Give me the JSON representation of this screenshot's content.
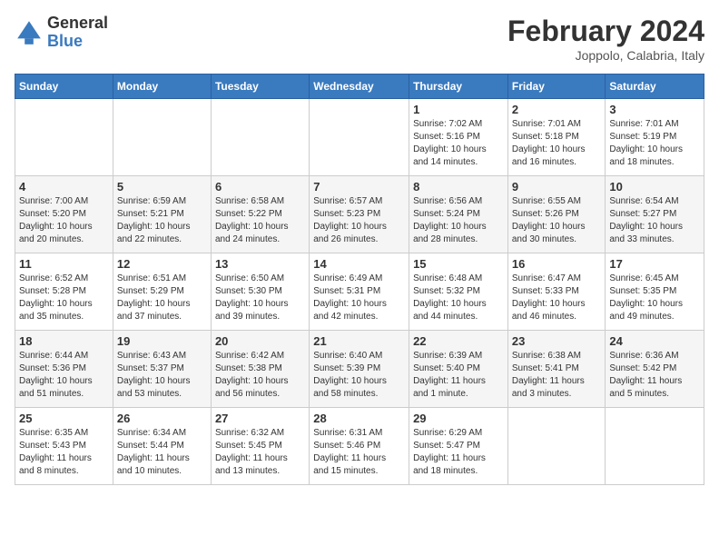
{
  "header": {
    "logo_general": "General",
    "logo_blue": "Blue",
    "month_title": "February 2024",
    "location": "Joppolo, Calabria, Italy"
  },
  "weekdays": [
    "Sunday",
    "Monday",
    "Tuesday",
    "Wednesday",
    "Thursday",
    "Friday",
    "Saturday"
  ],
  "weeks": [
    [
      {
        "day": "",
        "info": ""
      },
      {
        "day": "",
        "info": ""
      },
      {
        "day": "",
        "info": ""
      },
      {
        "day": "",
        "info": ""
      },
      {
        "day": "1",
        "info": "Sunrise: 7:02 AM\nSunset: 5:16 PM\nDaylight: 10 hours\nand 14 minutes."
      },
      {
        "day": "2",
        "info": "Sunrise: 7:01 AM\nSunset: 5:18 PM\nDaylight: 10 hours\nand 16 minutes."
      },
      {
        "day": "3",
        "info": "Sunrise: 7:01 AM\nSunset: 5:19 PM\nDaylight: 10 hours\nand 18 minutes."
      }
    ],
    [
      {
        "day": "4",
        "info": "Sunrise: 7:00 AM\nSunset: 5:20 PM\nDaylight: 10 hours\nand 20 minutes."
      },
      {
        "day": "5",
        "info": "Sunrise: 6:59 AM\nSunset: 5:21 PM\nDaylight: 10 hours\nand 22 minutes."
      },
      {
        "day": "6",
        "info": "Sunrise: 6:58 AM\nSunset: 5:22 PM\nDaylight: 10 hours\nand 24 minutes."
      },
      {
        "day": "7",
        "info": "Sunrise: 6:57 AM\nSunset: 5:23 PM\nDaylight: 10 hours\nand 26 minutes."
      },
      {
        "day": "8",
        "info": "Sunrise: 6:56 AM\nSunset: 5:24 PM\nDaylight: 10 hours\nand 28 minutes."
      },
      {
        "day": "9",
        "info": "Sunrise: 6:55 AM\nSunset: 5:26 PM\nDaylight: 10 hours\nand 30 minutes."
      },
      {
        "day": "10",
        "info": "Sunrise: 6:54 AM\nSunset: 5:27 PM\nDaylight: 10 hours\nand 33 minutes."
      }
    ],
    [
      {
        "day": "11",
        "info": "Sunrise: 6:52 AM\nSunset: 5:28 PM\nDaylight: 10 hours\nand 35 minutes."
      },
      {
        "day": "12",
        "info": "Sunrise: 6:51 AM\nSunset: 5:29 PM\nDaylight: 10 hours\nand 37 minutes."
      },
      {
        "day": "13",
        "info": "Sunrise: 6:50 AM\nSunset: 5:30 PM\nDaylight: 10 hours\nand 39 minutes."
      },
      {
        "day": "14",
        "info": "Sunrise: 6:49 AM\nSunset: 5:31 PM\nDaylight: 10 hours\nand 42 minutes."
      },
      {
        "day": "15",
        "info": "Sunrise: 6:48 AM\nSunset: 5:32 PM\nDaylight: 10 hours\nand 44 minutes."
      },
      {
        "day": "16",
        "info": "Sunrise: 6:47 AM\nSunset: 5:33 PM\nDaylight: 10 hours\nand 46 minutes."
      },
      {
        "day": "17",
        "info": "Sunrise: 6:45 AM\nSunset: 5:35 PM\nDaylight: 10 hours\nand 49 minutes."
      }
    ],
    [
      {
        "day": "18",
        "info": "Sunrise: 6:44 AM\nSunset: 5:36 PM\nDaylight: 10 hours\nand 51 minutes."
      },
      {
        "day": "19",
        "info": "Sunrise: 6:43 AM\nSunset: 5:37 PM\nDaylight: 10 hours\nand 53 minutes."
      },
      {
        "day": "20",
        "info": "Sunrise: 6:42 AM\nSunset: 5:38 PM\nDaylight: 10 hours\nand 56 minutes."
      },
      {
        "day": "21",
        "info": "Sunrise: 6:40 AM\nSunset: 5:39 PM\nDaylight: 10 hours\nand 58 minutes."
      },
      {
        "day": "22",
        "info": "Sunrise: 6:39 AM\nSunset: 5:40 PM\nDaylight: 11 hours\nand 1 minute."
      },
      {
        "day": "23",
        "info": "Sunrise: 6:38 AM\nSunset: 5:41 PM\nDaylight: 11 hours\nand 3 minutes."
      },
      {
        "day": "24",
        "info": "Sunrise: 6:36 AM\nSunset: 5:42 PM\nDaylight: 11 hours\nand 5 minutes."
      }
    ],
    [
      {
        "day": "25",
        "info": "Sunrise: 6:35 AM\nSunset: 5:43 PM\nDaylight: 11 hours\nand 8 minutes."
      },
      {
        "day": "26",
        "info": "Sunrise: 6:34 AM\nSunset: 5:44 PM\nDaylight: 11 hours\nand 10 minutes."
      },
      {
        "day": "27",
        "info": "Sunrise: 6:32 AM\nSunset: 5:45 PM\nDaylight: 11 hours\nand 13 minutes."
      },
      {
        "day": "28",
        "info": "Sunrise: 6:31 AM\nSunset: 5:46 PM\nDaylight: 11 hours\nand 15 minutes."
      },
      {
        "day": "29",
        "info": "Sunrise: 6:29 AM\nSunset: 5:47 PM\nDaylight: 11 hours\nand 18 minutes."
      },
      {
        "day": "",
        "info": ""
      },
      {
        "day": "",
        "info": ""
      }
    ]
  ]
}
